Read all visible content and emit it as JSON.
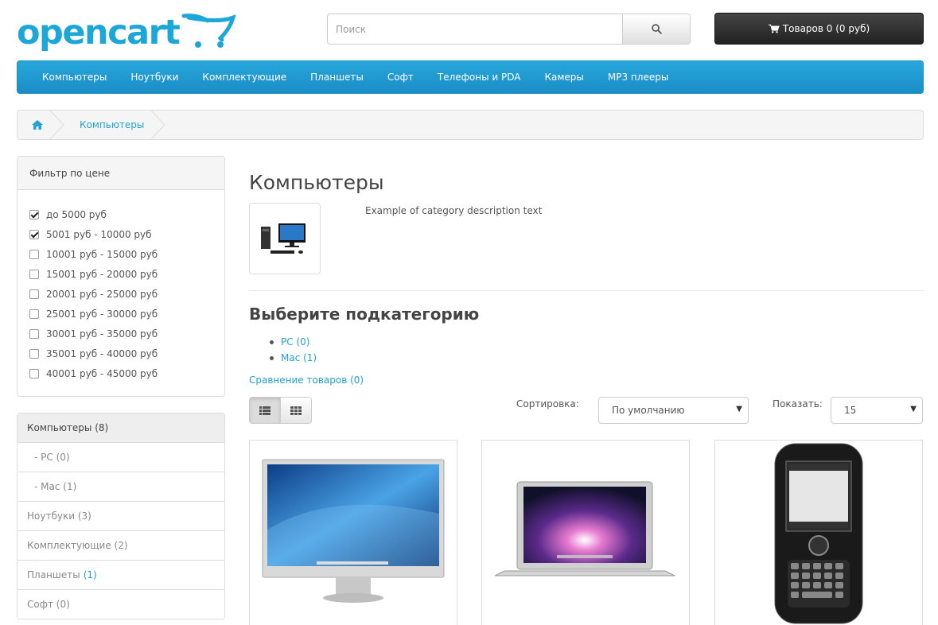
{
  "header": {
    "logo_text": "opencart",
    "search_placeholder": "Поиск",
    "cart_label": "Товаров 0 (0 руб)"
  },
  "menu": {
    "items": [
      {
        "label": "Компьютеры"
      },
      {
        "label": "Ноутбуки"
      },
      {
        "label": "Комплектующие"
      },
      {
        "label": "Планшеты"
      },
      {
        "label": "Софт"
      },
      {
        "label": "Телефоны и PDA"
      },
      {
        "label": "Камеры"
      },
      {
        "label": "MP3 плееры"
      }
    ]
  },
  "breadcrumb": {
    "items": [
      {
        "label": "Компьютеры"
      }
    ]
  },
  "filter": {
    "title": "Фильтр по цене",
    "options": [
      {
        "label": "до 5000 руб",
        "checked": true
      },
      {
        "label": "5001 руб - 10000 руб",
        "checked": true
      },
      {
        "label": "10001 руб - 15000 руб",
        "checked": false
      },
      {
        "label": "15001 руб - 20000 руб",
        "checked": false
      },
      {
        "label": "20001 руб - 25000 руб",
        "checked": false
      },
      {
        "label": "25001 руб - 30000 руб",
        "checked": false
      },
      {
        "label": "30001 руб - 35000 руб",
        "checked": false
      },
      {
        "label": "35001 руб - 40000 руб",
        "checked": false
      },
      {
        "label": "40001 руб - 45000 руб",
        "checked": false
      }
    ]
  },
  "categories": {
    "items": [
      {
        "label": "Компьютеры (8)",
        "active": true
      },
      {
        "label": "- PC (0)",
        "child": true
      },
      {
        "label": "- Mac (1)",
        "child": true
      },
      {
        "label": "Ноутбуки (3)"
      },
      {
        "label": "Комплектующие (2)"
      },
      {
        "label": "Планшеты",
        "count_link": "(1)"
      },
      {
        "label": "Софт (0)"
      }
    ]
  },
  "main": {
    "title": "Компьютеры",
    "description": "Example of category description text",
    "subcategories_title": "Выберите подкатегорию",
    "subcategories": [
      {
        "label": "PC (0)"
      },
      {
        "label": "Mac (1)"
      }
    ],
    "compare_link": "Сравнение товаров (0)",
    "sort_label": "Сортировка:",
    "sort_value": "По умолчанию",
    "show_label": "Показать:",
    "limit_value": "15"
  },
  "icons": {
    "search": "search-icon",
    "cart": "shopping-cart-icon",
    "home": "home-icon",
    "list_view": "list-view-icon",
    "grid_view": "grid-view-icon"
  },
  "colors": {
    "brand": "#1ca7d8",
    "menu_bg": "#229ac8",
    "link": "#23a1d1",
    "cart_bg": "#303030"
  }
}
